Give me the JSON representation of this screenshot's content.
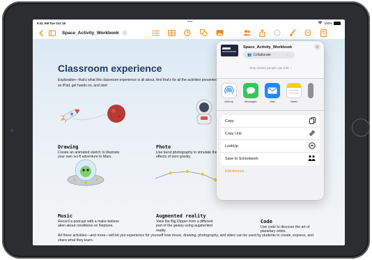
{
  "status": {
    "time": "9:41 AM  Tue Oct 18",
    "battery": "100%"
  },
  "toolbar": {
    "doc_name": "Space_Activity_Workbook"
  },
  "doc": {
    "title": "Classroom experience",
    "intro_lead": "Exploration",
    "intro_rest": "—that's what this classroom experience is all about. And that's for all the activities presented here. Grab an iPad, get hands on, and start",
    "activities": [
      {
        "heading": "Drawing",
        "desc": "Create an animated sketch to illustrate your own sci-fi adventure to Mars."
      },
      {
        "heading": "Photo",
        "desc": "Use burst photography to simulate the effects of zero gravity."
      },
      {
        "heading": "Music",
        "desc": "Record a podcast with a make-believe alien about conditions on Neptune."
      },
      {
        "heading": "Augmented reality",
        "desc": "View the Big Dipper from a different part of the galaxy using augmented reality."
      },
      {
        "heading": "Code",
        "desc": "Use code to discover the art of planetary orbits."
      }
    ],
    "footer": "All these activities—and more—will let you experience for yourself how music, drawing, photography, and video can be used by students to create, express, and share what they learn."
  },
  "share": {
    "file_name": "Space_Activity_Workbook",
    "collaborate_label": "Collaborate",
    "permission_text": "Only invited people can edit. ›",
    "apps": [
      {
        "label": "AirDrop",
        "color": "#ffffff",
        "icon": "airdrop-icon"
      },
      {
        "label": "Messages",
        "color": "#34c759",
        "icon": "messages-icon"
      },
      {
        "label": "Mail",
        "color": "#1e88ff",
        "icon": "mail-icon"
      },
      {
        "label": "Notes",
        "color": "#ffffff",
        "icon": "notes-icon"
      }
    ],
    "actions": [
      {
        "label": "Copy",
        "icon": "copy-icon"
      },
      {
        "label": "Copy Link",
        "icon": "link-icon"
      },
      {
        "label": "LookUp",
        "icon": "lookup-icon"
      },
      {
        "label": "Save to Schoolwork",
        "icon": "schoolwork-icon"
      }
    ],
    "edit_actions": "Edit Actions..."
  }
}
